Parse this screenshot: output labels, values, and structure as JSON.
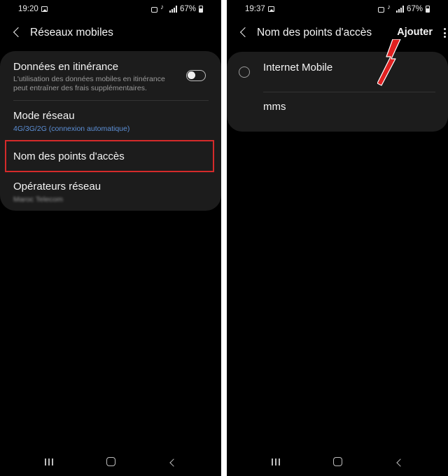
{
  "left_screen": {
    "status": {
      "time": "19:20",
      "battery": "67%"
    },
    "title": "Réseaux mobiles",
    "items": [
      {
        "title": "Données en itinérance",
        "subtitle": "L'utilisation des données mobiles en itinérance peut entraîner des frais supplémentaires.",
        "toggle": false
      },
      {
        "title": "Mode réseau",
        "value": "4G/3G/2G (connexion automatique)"
      },
      {
        "title": "Nom des points d'accès"
      },
      {
        "title": "Opérateurs réseau",
        "value": "Maroc Telecom"
      }
    ]
  },
  "right_screen": {
    "status": {
      "time": "19:37",
      "battery": "67%"
    },
    "title": "Nom des points d'accès",
    "action": "Ajouter",
    "apns": [
      {
        "name": "Internet Mobile",
        "selected": false
      },
      {
        "name": "mms"
      }
    ]
  },
  "icons": {
    "back": "chevron-left-icon",
    "more": "more-vertical-icon",
    "nav": [
      "recent-apps-icon",
      "home-icon",
      "back-icon"
    ]
  },
  "colors": {
    "background": "#000000",
    "card": "#1c1c1c",
    "accent_blue": "#5c8fd6",
    "highlight_red": "#d42a2a"
  }
}
